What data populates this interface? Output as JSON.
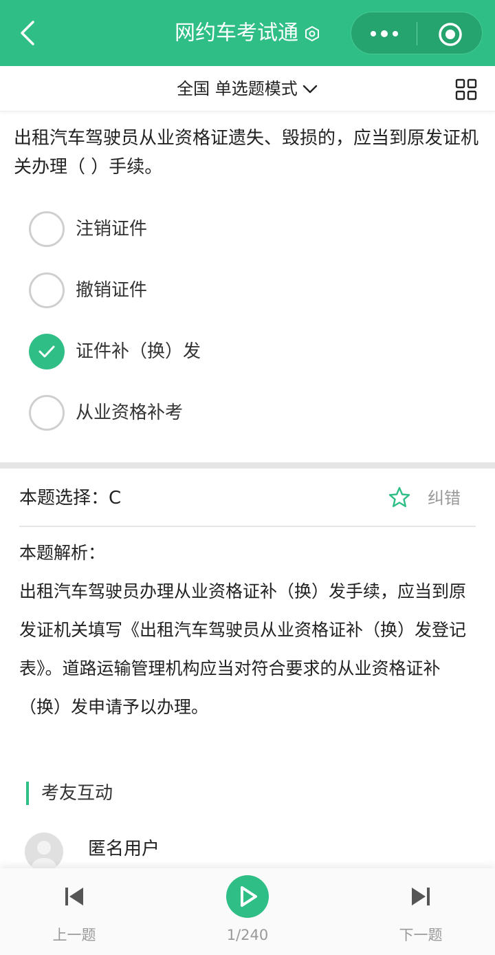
{
  "header": {
    "title": "网约车考试通",
    "icons": {
      "back": "back-chevron-icon",
      "badge": "hexagon-badge-icon",
      "more": "more-dots-icon",
      "close": "target-circle-icon"
    },
    "color": "#2fbf86"
  },
  "modebar": {
    "label": "全国 单选题模式",
    "icons": {
      "dropdown": "chevron-down-icon",
      "grid": "grid-icon"
    }
  },
  "question": {
    "text": "出租汽车驾驶员从业资格证遗失、毁损的，应当到原发证机关办理（ ）手续。",
    "options": [
      {
        "label": "注销证件",
        "selected": false
      },
      {
        "label": "撤销证件",
        "selected": false
      },
      {
        "label": "证件补（换）发",
        "selected": true
      },
      {
        "label": "从业资格补考",
        "selected": false
      }
    ]
  },
  "answer": {
    "label": "本题选择：C",
    "report_label": "纠错",
    "favorite_icon": "star-outline-icon"
  },
  "analysis": {
    "title": "本题解析：",
    "text": "出租汽车驾驶员办理从业资格证补（换）发手续，应当到原发证机关填写《出租汽车驾驶员从业资格证补（换）发登记表》。道路运输管理机构应当对符合要求的从业资格证补（换）发申请予以办理。"
  },
  "interaction": {
    "title": "考友互动",
    "user": "匿名用户"
  },
  "bottom": {
    "prev_label": "上一题",
    "next_label": "下一题",
    "counter": "1/240",
    "icons": {
      "prev": "skip-previous-icon",
      "play": "play-icon",
      "next": "skip-next-icon"
    }
  }
}
